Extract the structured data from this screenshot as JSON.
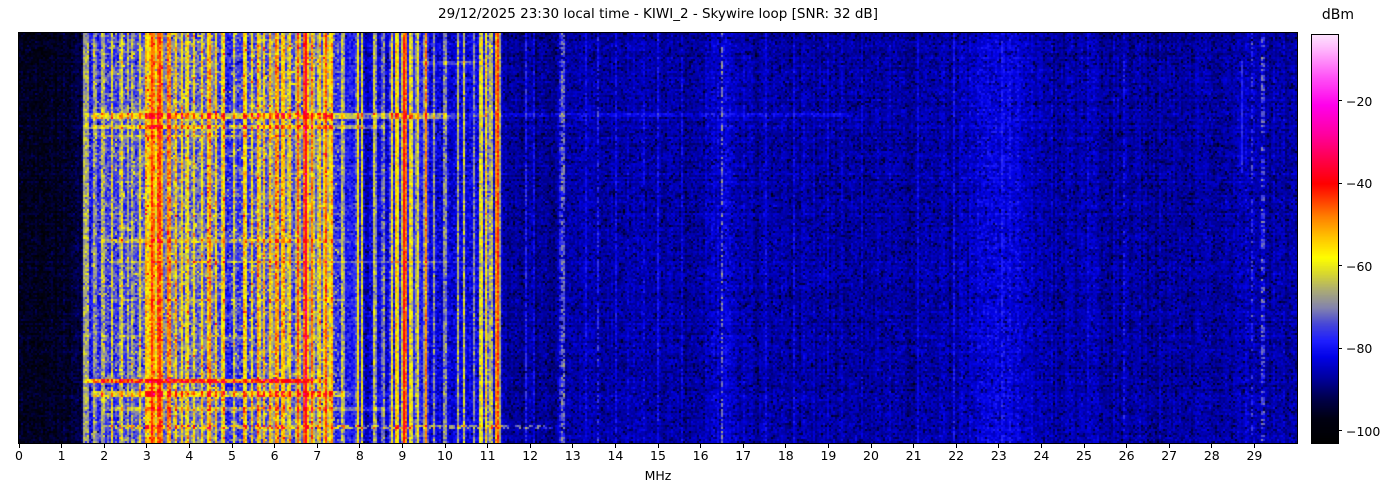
{
  "chart_data": {
    "type": "heatmap",
    "subtype": "radio-spectrum-waterfall",
    "title": "29/12/2025 23:30 local time - KIWI_2 - Skywire loop [SNR: 32 dB]",
    "xlabel": "MHz",
    "x_range": [
      0,
      30
    ],
    "x_ticks": [
      "0",
      "1",
      "2",
      "3",
      "4",
      "5",
      "6",
      "7",
      "8",
      "9",
      "10",
      "11",
      "12",
      "13",
      "14",
      "15",
      "16",
      "17",
      "18",
      "19",
      "20",
      "21",
      "22",
      "23",
      "24",
      "25",
      "26",
      "27",
      "28",
      "29"
    ],
    "colorbar": {
      "label": "dBm",
      "vmax": -4,
      "vmin": -103,
      "ticks": [
        {
          "v": -20,
          "label": "−20"
        },
        {
          "v": -40,
          "label": "−40"
        },
        {
          "v": -60,
          "label": "−60"
        },
        {
          "v": -80,
          "label": "−80"
        },
        {
          "v": -100,
          "label": "−100"
        }
      ]
    },
    "colormap_stops": [
      [
        -103,
        "#000000"
      ],
      [
        -97,
        "#010112"
      ],
      [
        -92,
        "#00004d"
      ],
      [
        -87,
        "#0000a0"
      ],
      [
        -82,
        "#0202e8"
      ],
      [
        -78,
        "#2020ff"
      ],
      [
        -74,
        "#4848d8"
      ],
      [
        -70,
        "#8585ad"
      ],
      [
        -66,
        "#aaaa77"
      ],
      [
        -62,
        "#d6d632"
      ],
      [
        -58,
        "#ffff00"
      ],
      [
        -53,
        "#ffc400"
      ],
      [
        -48,
        "#ff8000"
      ],
      [
        -43,
        "#ff2e00"
      ],
      [
        -40,
        "#ff0000"
      ],
      [
        -34,
        "#ff004d"
      ],
      [
        -28,
        "#ff00a0"
      ],
      [
        -21,
        "#ff00eb"
      ],
      [
        -14,
        "#ff55f7"
      ],
      [
        -7,
        "#ffbcfd"
      ],
      [
        -4,
        "#fde1fe"
      ]
    ],
    "noise_floor_dbm": [
      [
        0,
        -96
      ],
      [
        1.3,
        -94
      ],
      [
        1.5,
        -90
      ],
      [
        1.7,
        -79
      ],
      [
        2,
        -76
      ],
      [
        2.6,
        -74
      ],
      [
        3,
        -72
      ],
      [
        3.6,
        -71
      ],
      [
        4.4,
        -72
      ],
      [
        4.9,
        -78
      ],
      [
        5.25,
        -76
      ],
      [
        5.5,
        -73
      ],
      [
        6,
        -72
      ],
      [
        6.6,
        -72
      ],
      [
        7.3,
        -73
      ],
      [
        7.55,
        -78
      ],
      [
        7.9,
        -79
      ],
      [
        8.15,
        -83
      ],
      [
        8.6,
        -83
      ],
      [
        8.75,
        -78
      ],
      [
        9.3,
        -77
      ],
      [
        9.55,
        -81
      ],
      [
        10,
        -83
      ],
      [
        10.7,
        -81
      ],
      [
        11.05,
        -80
      ],
      [
        11.35,
        -86
      ],
      [
        11.8,
        -88
      ],
      [
        12.4,
        -87.5
      ],
      [
        13,
        -86
      ],
      [
        14,
        -86
      ],
      [
        15,
        -86.5
      ],
      [
        16.1,
        -86
      ],
      [
        16.5,
        -82.5
      ],
      [
        16.9,
        -85.5
      ],
      [
        18,
        -86
      ],
      [
        20,
        -86.5
      ],
      [
        21.8,
        -86
      ],
      [
        22.5,
        -84
      ],
      [
        23.1,
        -81.5
      ],
      [
        23.7,
        -84
      ],
      [
        24.2,
        -86
      ],
      [
        26,
        -86.5
      ],
      [
        28,
        -86
      ],
      [
        29,
        -85.5
      ],
      [
        30,
        -86.5
      ]
    ],
    "signals": [
      {
        "f": 1.55,
        "w": 0.025,
        "db": -60,
        "fl": 7
      },
      {
        "f": 1.62,
        "w": 0.02,
        "db": -66,
        "fl": 7
      },
      {
        "f": 1.78,
        "w": 0.025,
        "db": -62,
        "fl": 8
      },
      {
        "f": 1.97,
        "w": 0.025,
        "db": -59,
        "fl": 8
      },
      {
        "f": 2.18,
        "w": 0.025,
        "db": -61,
        "fl": 8
      },
      {
        "f": 2.4,
        "w": 0.03,
        "db": -57,
        "fl": 8
      },
      {
        "f": 2.55,
        "w": 0.02,
        "db": -64,
        "fl": 8
      },
      {
        "f": 2.67,
        "w": 0.025,
        "db": -62,
        "fl": 8
      },
      {
        "f": 2.85,
        "w": 0.03,
        "db": -59,
        "fl": 8
      },
      {
        "f": 3.0,
        "w": 0.04,
        "db": -50,
        "fl": 8
      },
      {
        "f": 3.13,
        "w": 0.06,
        "db": -43,
        "fl": 6
      },
      {
        "f": 3.3,
        "w": 0.07,
        "db": -42,
        "fl": 6
      },
      {
        "f": 3.52,
        "w": 0.05,
        "db": -46,
        "fl": 7
      },
      {
        "f": 3.68,
        "w": 0.04,
        "db": -53,
        "fl": 8
      },
      {
        "f": 3.82,
        "w": 0.04,
        "db": -56,
        "fl": 8
      },
      {
        "f": 3.95,
        "w": 0.04,
        "db": -54,
        "fl": 8
      },
      {
        "f": 4.1,
        "w": 0.03,
        "db": -58,
        "fl": 8
      },
      {
        "f": 4.3,
        "w": 0.04,
        "db": -56,
        "fl": 8
      },
      {
        "f": 4.47,
        "w": 0.05,
        "db": -49,
        "fl": 8
      },
      {
        "f": 4.62,
        "w": 0.04,
        "db": -55,
        "fl": 8
      },
      {
        "f": 4.8,
        "w": 0.04,
        "db": -52,
        "fl": 8
      },
      {
        "f": 5.06,
        "w": 0.02,
        "db": -60,
        "fl": 8
      },
      {
        "f": 5.3,
        "w": 0.04,
        "db": -50,
        "fl": 8
      },
      {
        "f": 5.47,
        "w": 0.03,
        "db": -58,
        "fl": 8
      },
      {
        "f": 5.62,
        "w": 0.04,
        "db": -50,
        "fl": 8
      },
      {
        "f": 5.75,
        "w": 0.04,
        "db": -54,
        "fl": 8
      },
      {
        "f": 5.9,
        "w": 0.04,
        "db": -52,
        "fl": 8
      },
      {
        "f": 6.05,
        "w": 0.05,
        "db": -47,
        "fl": 7
      },
      {
        "f": 6.2,
        "w": 0.05,
        "db": -50,
        "fl": 7
      },
      {
        "f": 6.35,
        "w": 0.04,
        "db": -54,
        "fl": 8
      },
      {
        "f": 6.55,
        "w": 0.04,
        "db": -46,
        "fl": 7
      },
      {
        "f": 6.73,
        "w": 0.045,
        "db": -36,
        "fl": 4
      },
      {
        "f": 6.88,
        "w": 0.04,
        "db": -48,
        "fl": 7
      },
      {
        "f": 7.05,
        "w": 0.035,
        "db": -52,
        "fl": 8
      },
      {
        "f": 7.2,
        "w": 0.045,
        "db": -46,
        "fl": 7
      },
      {
        "f": 7.33,
        "w": 0.035,
        "db": -49,
        "fl": 7
      },
      {
        "f": 7.6,
        "w": 0.02,
        "db": -59,
        "fl": 8
      },
      {
        "f": 7.95,
        "w": 0.02,
        "db": -57,
        "fl": 7
      },
      {
        "f": 8.05,
        "w": 0.018,
        "db": -60,
        "fl": 7
      },
      {
        "f": 8.35,
        "w": 0.018,
        "db": -59,
        "fl": 8
      },
      {
        "f": 8.55,
        "w": 0.015,
        "db": -65,
        "fl": 8
      },
      {
        "f": 8.75,
        "w": 0.025,
        "db": -57,
        "fl": 8
      },
      {
        "f": 8.87,
        "w": 0.03,
        "db": -50,
        "fl": 8
      },
      {
        "f": 9.05,
        "w": 0.045,
        "db": -40,
        "fl": 5
      },
      {
        "f": 9.2,
        "w": 0.03,
        "db": -54,
        "fl": 8
      },
      {
        "f": 9.35,
        "w": 0.025,
        "db": -57,
        "fl": 8
      },
      {
        "f": 9.55,
        "w": 0.018,
        "db": -48,
        "fl": 6
      },
      {
        "f": 9.75,
        "w": 0.015,
        "db": -67,
        "fl": 8
      },
      {
        "f": 10.0,
        "w": 0.018,
        "db": -63,
        "fl": 8
      },
      {
        "f": 10.3,
        "w": 0.015,
        "db": -65,
        "fl": 8
      },
      {
        "f": 10.45,
        "w": 0.015,
        "db": -63,
        "fl": 8
      },
      {
        "f": 10.68,
        "w": 0.015,
        "db": -68,
        "fl": 7
      },
      {
        "f": 10.85,
        "w": 0.05,
        "db": -57,
        "fl": 8
      },
      {
        "f": 10.97,
        "w": 0.035,
        "db": -55,
        "fl": 8
      },
      {
        "f": 11.08,
        "w": 0.025,
        "db": -59,
        "fl": 8
      },
      {
        "f": 11.23,
        "w": 0.045,
        "db": -42,
        "fl": 5
      },
      {
        "f": 11.9,
        "w": 0.015,
        "db": -79,
        "fl": 6
      },
      {
        "f": 12.1,
        "w": 0.012,
        "db": -81,
        "fl": 5
      },
      {
        "f": 12.73,
        "w": 0.018,
        "db": -69,
        "fl": 7,
        "duty": 0.85
      },
      {
        "f": 12.8,
        "w": 0.013,
        "db": -72,
        "fl": 7,
        "duty": 0.8
      },
      {
        "f": 13.3,
        "w": 0.012,
        "db": -80,
        "fl": 5
      },
      {
        "f": 13.6,
        "w": 0.012,
        "db": -77,
        "fl": 6,
        "duty": 0.7
      },
      {
        "f": 14.0,
        "w": 0.012,
        "db": -80,
        "fl": 5
      },
      {
        "f": 14.65,
        "w": 0.012,
        "db": -78,
        "fl": 6
      },
      {
        "f": 15.0,
        "w": 0.015,
        "db": -80,
        "fl": 5
      },
      {
        "f": 15.55,
        "w": 0.012,
        "db": -80,
        "fl": 5
      },
      {
        "f": 16.5,
        "w": 0.018,
        "db": -71,
        "fl": 6,
        "duty": 0.65
      },
      {
        "f": 17.55,
        "w": 0.012,
        "db": -80,
        "fl": 5
      },
      {
        "f": 18.2,
        "w": 0.012,
        "db": -81,
        "fl": 5
      },
      {
        "f": 19.0,
        "w": 0.012,
        "db": -82,
        "fl": 4
      },
      {
        "f": 19.8,
        "w": 0.012,
        "db": -82,
        "fl": 4
      },
      {
        "f": 21.1,
        "w": 0.012,
        "db": -82,
        "fl": 4
      },
      {
        "f": 21.95,
        "w": 0.012,
        "db": -80,
        "fl": 5
      },
      {
        "f": 23.25,
        "w": 0.012,
        "db": -79,
        "fl": 5
      },
      {
        "f": 24.0,
        "w": 0.012,
        "db": -82,
        "fl": 4
      },
      {
        "f": 25.1,
        "w": 0.012,
        "db": -82,
        "fl": 4
      },
      {
        "f": 25.95,
        "w": 0.012,
        "db": -79,
        "fl": 5,
        "duty": 0.5
      },
      {
        "f": 27.0,
        "w": 0.012,
        "db": -82,
        "fl": 4
      },
      {
        "f": 28.7,
        "w": 0.018,
        "db": -77,
        "fl": 4,
        "r0": 0.06,
        "r1": 0.34
      },
      {
        "f": 28.95,
        "w": 0.016,
        "db": -76,
        "fl": 6,
        "duty": 0.5
      },
      {
        "f": 29.2,
        "w": 0.016,
        "db": -68,
        "fl": 6,
        "duty": 0.55
      }
    ],
    "time_streaks": [
      {
        "row": 0.07,
        "rows": 2,
        "f0": 9.3,
        "f1": 11.1,
        "db": 8
      },
      {
        "row": 0.195,
        "rows": 3,
        "f0": 1.5,
        "f1": 10.5,
        "db": 14
      },
      {
        "row": 0.195,
        "rows": 2,
        "f0": 10.5,
        "f1": 20.0,
        "db": 4
      },
      {
        "row": 0.225,
        "rows": 2,
        "f0": 1.5,
        "f1": 8.8,
        "db": 10
      },
      {
        "row": 0.25,
        "rows": 1,
        "f0": 1.8,
        "f1": 7.2,
        "db": 7
      },
      {
        "row": 0.5,
        "rows": 2,
        "f0": 1.8,
        "f1": 8.0,
        "db": 7
      },
      {
        "row": 0.555,
        "rows": 1,
        "f0": 2.0,
        "f1": 10.5,
        "db": 6
      },
      {
        "row": 0.65,
        "rows": 1,
        "f0": 2.0,
        "f1": 8.0,
        "db": 5
      },
      {
        "row": 0.845,
        "rows": 2,
        "f0": 1.5,
        "f1": 7.3,
        "db": 26
      },
      {
        "row": 0.875,
        "rows": 3,
        "f0": 1.6,
        "f1": 8.0,
        "db": 13
      },
      {
        "row": 0.91,
        "rows": 2,
        "f0": 2.0,
        "f1": 9.0,
        "db": 8
      },
      {
        "row": 0.955,
        "rows": 2,
        "f0": 2.0,
        "f1": 12.9,
        "db": 16,
        "dashed": true
      }
    ]
  }
}
